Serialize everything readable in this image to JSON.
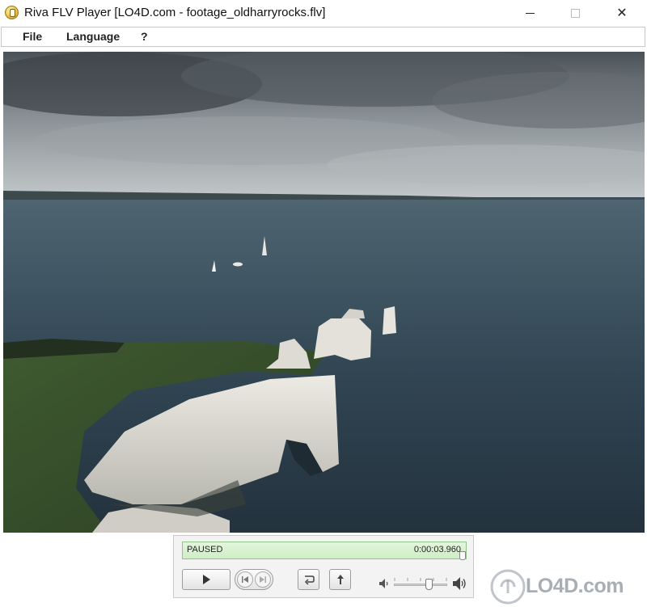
{
  "window": {
    "title": "Riva FLV Player [LO4D.com - footage_oldharryrocks.flv]",
    "minimize_glyph": "—",
    "close_glyph": "✕"
  },
  "menu": {
    "items": [
      {
        "label": "File"
      },
      {
        "label": "Language"
      },
      {
        "label": "?"
      }
    ]
  },
  "video": {
    "content": "aerial footage of chalk sea stacks and cliffs",
    "icon": "video-frame"
  },
  "player": {
    "status": "PAUSED",
    "time": "0:00:03.960",
    "seek_progress": 0.99,
    "volume_level": 0.7,
    "buttons": {
      "play": "play-icon",
      "prev": "skip-back-icon",
      "next": "skip-forward-icon",
      "loop": "loop-icon",
      "eject": "eject-icon",
      "volume_low": "speaker-low-icon",
      "volume_high": "speaker-high-icon"
    }
  },
  "watermark": {
    "text": "LO4D.com"
  },
  "colors": {
    "status_bar": "#d6f1cd",
    "status_border": "#93c38b",
    "window_bg": "#ffffff"
  }
}
